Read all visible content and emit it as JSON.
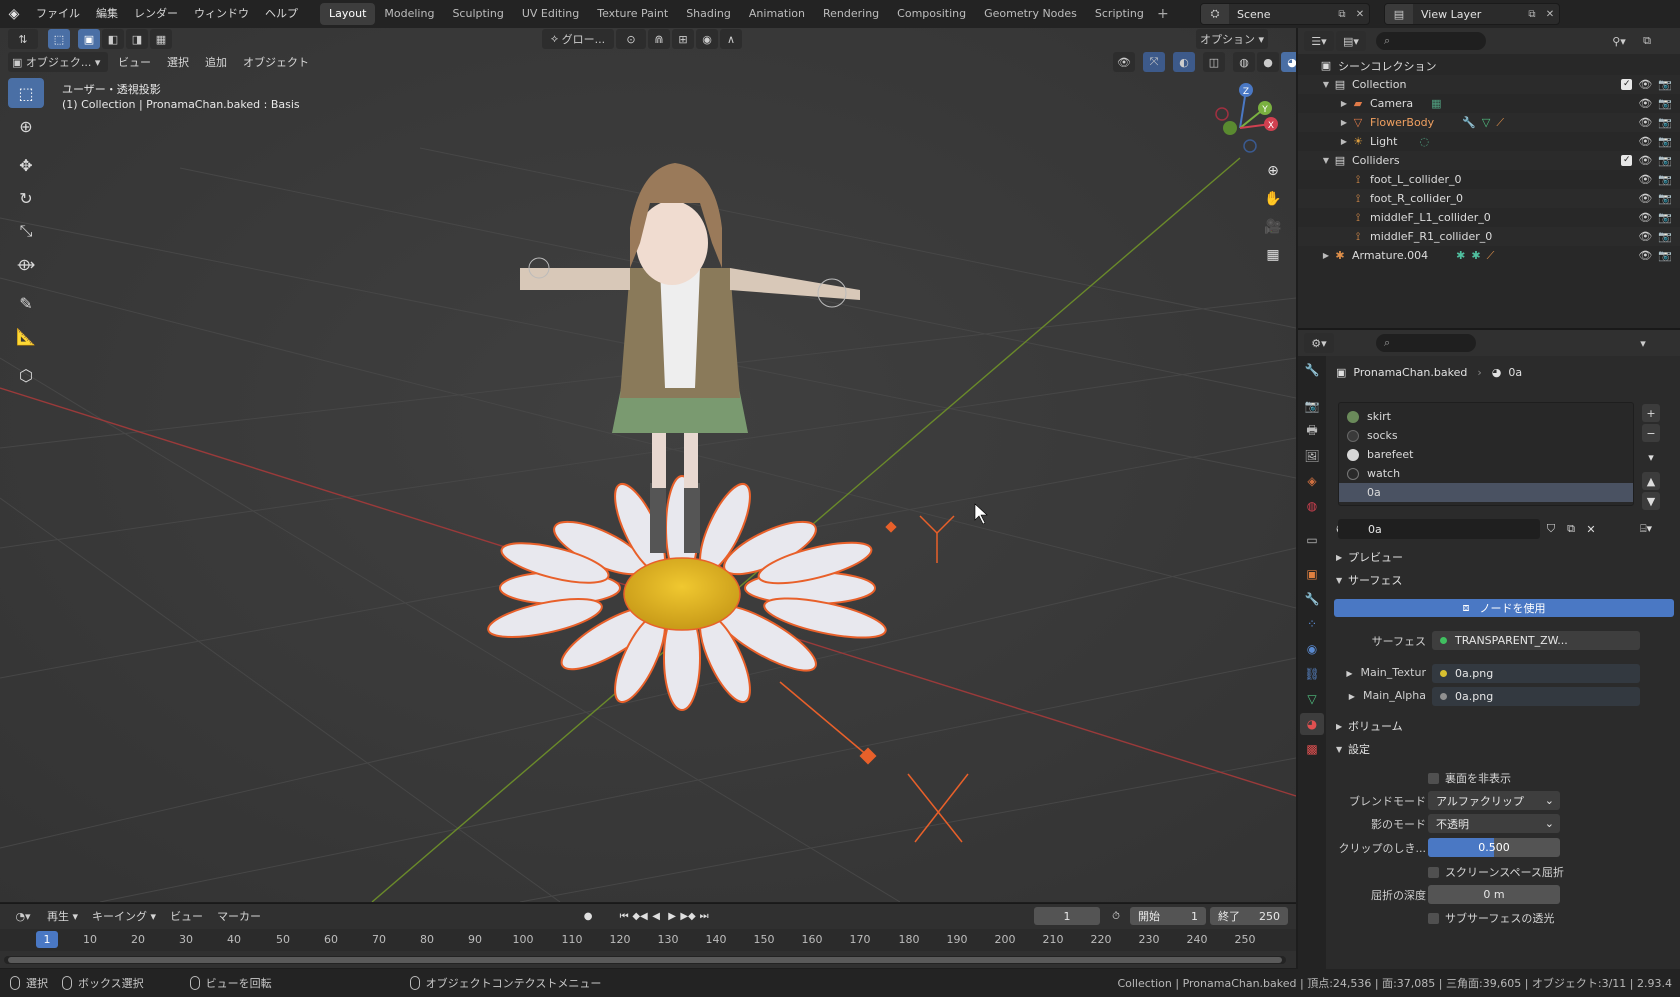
{
  "topbar": {
    "menus": [
      "ファイル",
      "編集",
      "レンダー",
      "ウィンドウ",
      "ヘルプ"
    ],
    "workspaces": [
      "Layout",
      "Modeling",
      "Sculpting",
      "UV Editing",
      "Texture Paint",
      "Shading",
      "Animation",
      "Rendering",
      "Compositing",
      "Geometry Nodes",
      "Scripting"
    ],
    "active_workspace": "Layout",
    "scene": "Scene",
    "view_layer": "View Layer"
  },
  "viewport": {
    "mode": "オブジェク...",
    "menus": [
      "ビュー",
      "選択",
      "追加",
      "オブジェクト"
    ],
    "transform_orientation": "グロー...",
    "options_label": "オプション",
    "info_line1": "ユーザー・透視投影",
    "info_line2": "(1) Collection | PronamaChan.baked : Basis",
    "gizmo": {
      "x": "X",
      "y": "Y",
      "z": "Z"
    }
  },
  "timeline": {
    "menus": [
      "再生",
      "キーイング",
      "ビュー",
      "マーカー"
    ],
    "current_frame": "1",
    "start_label": "開始",
    "start": "1",
    "end_label": "終了",
    "end": "250",
    "ticks": [
      "10",
      "20",
      "30",
      "40",
      "50",
      "60",
      "70",
      "80",
      "90",
      "100",
      "110",
      "120",
      "130",
      "140",
      "150",
      "160",
      "170",
      "180",
      "190",
      "200",
      "210",
      "220",
      "230",
      "240",
      "250"
    ],
    "ruler_frame": "1"
  },
  "statusbar": {
    "select": "選択",
    "box_select": "ボックス選択",
    "rotate_view": "ビューを回転",
    "context_menu": "オブジェクトコンテクストメニュー",
    "stats": "Collection | PronamaChan.baked | 頂点:24,536 | 面:37,085 | 三角面:39,605 | オブジェクト:3/11 | 2.93.4"
  },
  "outliner": {
    "scene_collection": "シーンコレクション",
    "rows": [
      {
        "label": "Collection",
        "icon_color": "#d8d8d8"
      },
      {
        "label": "Camera",
        "icon_color": "#e07a48"
      },
      {
        "label": "FlowerBody",
        "icon_color": "#e07a48",
        "text_color": "#f0a060"
      },
      {
        "label": "Light",
        "icon_color": "#e0a040"
      },
      {
        "label": "Colliders",
        "icon_color": "#d8d8d8"
      },
      {
        "label": "foot_L_collider_0",
        "icon_color": "#e0904a"
      },
      {
        "label": "foot_R_collider_0",
        "icon_color": "#e0904a"
      },
      {
        "label": "middleF_L1_collider_0",
        "icon_color": "#e0904a"
      },
      {
        "label": "middleF_R1_collider_0",
        "icon_color": "#e0904a"
      },
      {
        "label": "Armature.004",
        "icon_color": "#e0904a"
      }
    ]
  },
  "properties": {
    "object_name": "PronamaChan.baked",
    "material_name": "0a",
    "slots": [
      {
        "label": "skirt",
        "color": "#6a8a5a"
      },
      {
        "label": "socks",
        "color": "#3a3a3a"
      },
      {
        "label": "barefeet",
        "color": "#d8d8d8"
      },
      {
        "label": "watch",
        "color": "#2a2a2a"
      },
      {
        "label": "0a",
        "color": ""
      }
    ],
    "material_field": "0a",
    "preview_label": "プレビュー",
    "surface_label": "サーフェス",
    "use_nodes": "ノードを使用",
    "surface_prop_label": "サーフェス",
    "surface_value": "TRANSPARENT_ZW...",
    "main_texture_label": "Main_Textur",
    "main_texture_value": "0a.png",
    "main_alpha_label": "Main_Alpha",
    "main_alpha_value": "0a.png",
    "volume_label": "ボリューム",
    "settings_label": "設定",
    "backface_label": "裏面を非表示",
    "blend_mode_label": "ブレンドモード",
    "blend_mode_value": "アルファクリップ",
    "shadow_mode_label": "影のモード",
    "shadow_mode_value": "不透明",
    "clip_threshold_label": "クリップのしき...",
    "clip_threshold_value": "0.500",
    "clip_threshold_fraction": 0.5,
    "ssr_label": "スクリーンスペース屈折",
    "refraction_depth_label": "屈折の深度",
    "refraction_depth_value": "0 m",
    "subsurface_label": "サブサーフェスの透光"
  }
}
